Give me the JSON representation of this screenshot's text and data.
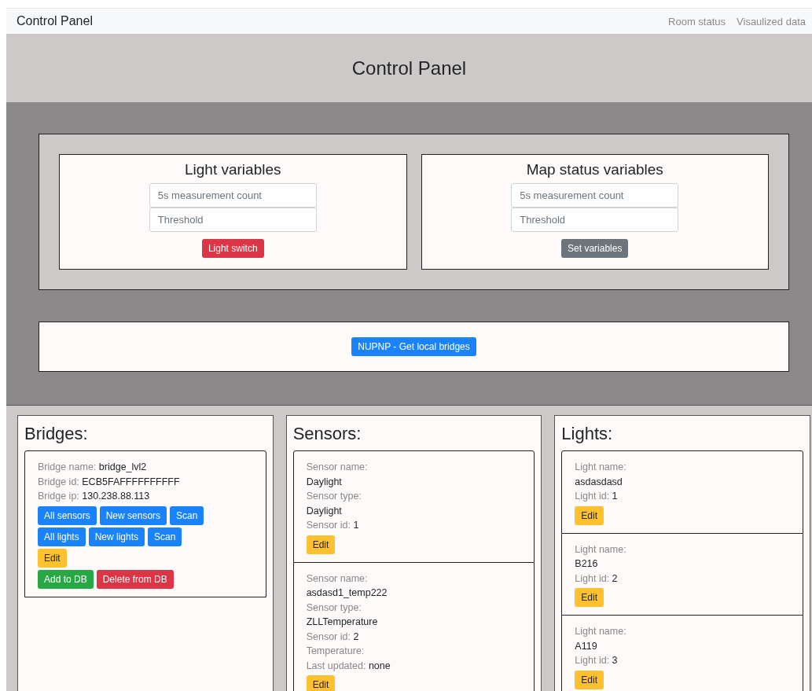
{
  "navbar": {
    "brand": "Control Panel",
    "links": [
      "Room status",
      "Visaulized data"
    ]
  },
  "header": {
    "title": "Control Panel"
  },
  "variable_panels": [
    {
      "title": "Light variables",
      "fields": [
        {
          "placeholder": "5s measurement count"
        },
        {
          "placeholder": "Threshold"
        }
      ],
      "button": {
        "label": "Light switch",
        "kind": "danger"
      }
    },
    {
      "title": "Map status variables",
      "fields": [
        {
          "placeholder": "5s measurement count"
        },
        {
          "placeholder": "Threshold"
        }
      ],
      "button": {
        "label": "Set variables",
        "kind": "secondary"
      }
    }
  ],
  "bridge_search": {
    "button": {
      "label": "NUPNP - Get local bridges",
      "kind": "primary"
    }
  },
  "columns": [
    {
      "title": "Bridges:",
      "items": [
        {
          "fields": [
            {
              "label": "Bridge name:",
              "value": "bridge_lvl2",
              "kind": "inline"
            },
            {
              "label": "Bridge id:",
              "value": "ECB5FAFFFFFFFFFF",
              "kind": "inline"
            },
            {
              "label": "Bridge ip:",
              "value": "130.238.88.113",
              "kind": "inline"
            }
          ],
          "button_rows": [
            [
              {
                "label": "All sensors",
                "kind": "primary"
              },
              {
                "label": "New sensors",
                "kind": "primary"
              },
              {
                "label": "Scan",
                "kind": "primary"
              }
            ],
            [
              {
                "label": "All lights",
                "kind": "primary"
              },
              {
                "label": "New lights",
                "kind": "primary"
              },
              {
                "label": "Scan",
                "kind": "primary"
              }
            ],
            [
              {
                "label": "Edit",
                "kind": "warning"
              }
            ],
            [
              {
                "label": "Add to DB",
                "kind": "success"
              },
              {
                "label": "Delete from DB",
                "kind": "danger"
              }
            ]
          ]
        }
      ]
    },
    {
      "title": "Sensors:",
      "items": [
        {
          "fields": [
            {
              "label": "Sensor name:",
              "value": "Daylight",
              "kind": "stacked"
            },
            {
              "label": "Sensor type:",
              "value": "Daylight",
              "kind": "stacked"
            },
            {
              "label": "Sensor id:",
              "value": "1",
              "kind": "inline"
            }
          ],
          "button_rows": [
            [
              {
                "label": "Edit",
                "kind": "warning"
              }
            ]
          ]
        },
        {
          "fields": [
            {
              "label": "Sensor name:",
              "value": "asdasd1_temp222",
              "kind": "stacked"
            },
            {
              "label": "Sensor type:",
              "value": "ZLLTemperature",
              "kind": "stacked"
            },
            {
              "label": "Sensor id:",
              "value": "2",
              "kind": "inline"
            },
            {
              "label": "Temperature:",
              "kind": "inline"
            },
            {
              "label": "Last updated:",
              "value": "none",
              "kind": "inline"
            }
          ],
          "button_rows": [
            [
              {
                "label": "Edit",
                "kind": "warning"
              }
            ]
          ]
        }
      ]
    },
    {
      "title": "Lights:",
      "items": [
        {
          "fields": [
            {
              "label": "Light name:",
              "value": "asdasdasd",
              "kind": "stacked"
            },
            {
              "label": "Light id:",
              "value": "1",
              "kind": "inline"
            }
          ],
          "button_rows": [
            [
              {
                "label": "Edit",
                "kind": "warning"
              }
            ]
          ]
        },
        {
          "fields": [
            {
              "label": "Light name:",
              "value": "B216",
              "kind": "stacked"
            },
            {
              "label": "Light id:",
              "value": "2",
              "kind": "inline"
            }
          ],
          "button_rows": [
            [
              {
                "label": "Edit",
                "kind": "warning"
              }
            ]
          ]
        },
        {
          "fields": [
            {
              "label": "Light name:",
              "value": "A119",
              "kind": "stacked"
            },
            {
              "label": "Light id:",
              "value": "3",
              "kind": "inline"
            }
          ],
          "button_rows": [
            [
              {
                "label": "Edit",
                "kind": "warning"
              }
            ]
          ]
        }
      ]
    }
  ]
}
